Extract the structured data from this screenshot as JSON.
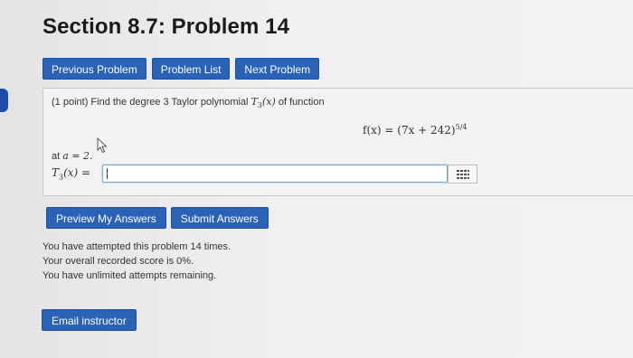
{
  "page": {
    "title": "Section 8.7: Problem 14"
  },
  "nav": {
    "previous": "Previous Problem",
    "list": "Problem List",
    "next": "Next Problem"
  },
  "problem": {
    "points": "(1 point)",
    "prompt_text": "Find the degree 3 Taylor polynomial",
    "polynomial": "T3(x)",
    "prompt_end": "of function",
    "function": "f(x) = (7x + 242)",
    "exponent": "5/4",
    "at_text": "at",
    "at_value": "a = 2.",
    "answer_label": "T3(x) =",
    "answer_value": "",
    "answer_placeholder": ""
  },
  "actions": {
    "preview": "Preview My Answers",
    "submit": "Submit Answers"
  },
  "status": {
    "attempts": "You have attempted this problem 14 times.",
    "score": "Your overall recorded score is 0%.",
    "remaining": "You have unlimited attempts remaining."
  },
  "footer": {
    "email": "Email instructor"
  },
  "colors": {
    "button": "#2a62b7",
    "input_border": "#7fa3d6",
    "marker": "#1f4ea8"
  },
  "icons": {
    "equation_editor": "grid-icon",
    "pointer": "mouse-pointer-icon"
  }
}
